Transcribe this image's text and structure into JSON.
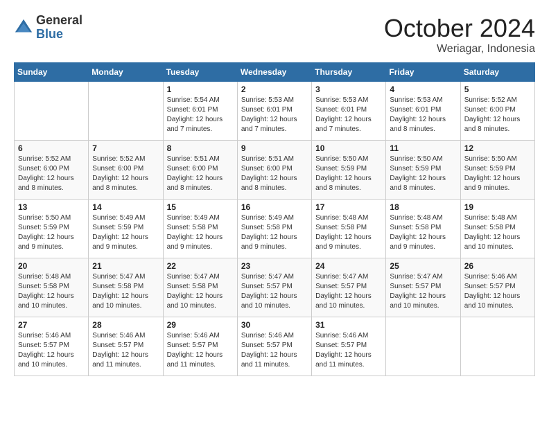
{
  "logo": {
    "general": "General",
    "blue": "Blue"
  },
  "header": {
    "month": "October 2024",
    "location": "Weriagar, Indonesia"
  },
  "weekdays": [
    "Sunday",
    "Monday",
    "Tuesday",
    "Wednesday",
    "Thursday",
    "Friday",
    "Saturday"
  ],
  "weeks": [
    [
      {
        "day": "",
        "sunrise": "",
        "sunset": "",
        "daylight": ""
      },
      {
        "day": "",
        "sunrise": "",
        "sunset": "",
        "daylight": ""
      },
      {
        "day": "1",
        "sunrise": "Sunrise: 5:54 AM",
        "sunset": "Sunset: 6:01 PM",
        "daylight": "Daylight: 12 hours and 7 minutes."
      },
      {
        "day": "2",
        "sunrise": "Sunrise: 5:53 AM",
        "sunset": "Sunset: 6:01 PM",
        "daylight": "Daylight: 12 hours and 7 minutes."
      },
      {
        "day": "3",
        "sunrise": "Sunrise: 5:53 AM",
        "sunset": "Sunset: 6:01 PM",
        "daylight": "Daylight: 12 hours and 7 minutes."
      },
      {
        "day": "4",
        "sunrise": "Sunrise: 5:53 AM",
        "sunset": "Sunset: 6:01 PM",
        "daylight": "Daylight: 12 hours and 8 minutes."
      },
      {
        "day": "5",
        "sunrise": "Sunrise: 5:52 AM",
        "sunset": "Sunset: 6:00 PM",
        "daylight": "Daylight: 12 hours and 8 minutes."
      }
    ],
    [
      {
        "day": "6",
        "sunrise": "Sunrise: 5:52 AM",
        "sunset": "Sunset: 6:00 PM",
        "daylight": "Daylight: 12 hours and 8 minutes."
      },
      {
        "day": "7",
        "sunrise": "Sunrise: 5:52 AM",
        "sunset": "Sunset: 6:00 PM",
        "daylight": "Daylight: 12 hours and 8 minutes."
      },
      {
        "day": "8",
        "sunrise": "Sunrise: 5:51 AM",
        "sunset": "Sunset: 6:00 PM",
        "daylight": "Daylight: 12 hours and 8 minutes."
      },
      {
        "day": "9",
        "sunrise": "Sunrise: 5:51 AM",
        "sunset": "Sunset: 6:00 PM",
        "daylight": "Daylight: 12 hours and 8 minutes."
      },
      {
        "day": "10",
        "sunrise": "Sunrise: 5:50 AM",
        "sunset": "Sunset: 5:59 PM",
        "daylight": "Daylight: 12 hours and 8 minutes."
      },
      {
        "day": "11",
        "sunrise": "Sunrise: 5:50 AM",
        "sunset": "Sunset: 5:59 PM",
        "daylight": "Daylight: 12 hours and 8 minutes."
      },
      {
        "day": "12",
        "sunrise": "Sunrise: 5:50 AM",
        "sunset": "Sunset: 5:59 PM",
        "daylight": "Daylight: 12 hours and 9 minutes."
      }
    ],
    [
      {
        "day": "13",
        "sunrise": "Sunrise: 5:50 AM",
        "sunset": "Sunset: 5:59 PM",
        "daylight": "Daylight: 12 hours and 9 minutes."
      },
      {
        "day": "14",
        "sunrise": "Sunrise: 5:49 AM",
        "sunset": "Sunset: 5:59 PM",
        "daylight": "Daylight: 12 hours and 9 minutes."
      },
      {
        "day": "15",
        "sunrise": "Sunrise: 5:49 AM",
        "sunset": "Sunset: 5:58 PM",
        "daylight": "Daylight: 12 hours and 9 minutes."
      },
      {
        "day": "16",
        "sunrise": "Sunrise: 5:49 AM",
        "sunset": "Sunset: 5:58 PM",
        "daylight": "Daylight: 12 hours and 9 minutes."
      },
      {
        "day": "17",
        "sunrise": "Sunrise: 5:48 AM",
        "sunset": "Sunset: 5:58 PM",
        "daylight": "Daylight: 12 hours and 9 minutes."
      },
      {
        "day": "18",
        "sunrise": "Sunrise: 5:48 AM",
        "sunset": "Sunset: 5:58 PM",
        "daylight": "Daylight: 12 hours and 9 minutes."
      },
      {
        "day": "19",
        "sunrise": "Sunrise: 5:48 AM",
        "sunset": "Sunset: 5:58 PM",
        "daylight": "Daylight: 12 hours and 10 minutes."
      }
    ],
    [
      {
        "day": "20",
        "sunrise": "Sunrise: 5:48 AM",
        "sunset": "Sunset: 5:58 PM",
        "daylight": "Daylight: 12 hours and 10 minutes."
      },
      {
        "day": "21",
        "sunrise": "Sunrise: 5:47 AM",
        "sunset": "Sunset: 5:58 PM",
        "daylight": "Daylight: 12 hours and 10 minutes."
      },
      {
        "day": "22",
        "sunrise": "Sunrise: 5:47 AM",
        "sunset": "Sunset: 5:58 PM",
        "daylight": "Daylight: 12 hours and 10 minutes."
      },
      {
        "day": "23",
        "sunrise": "Sunrise: 5:47 AM",
        "sunset": "Sunset: 5:57 PM",
        "daylight": "Daylight: 12 hours and 10 minutes."
      },
      {
        "day": "24",
        "sunrise": "Sunrise: 5:47 AM",
        "sunset": "Sunset: 5:57 PM",
        "daylight": "Daylight: 12 hours and 10 minutes."
      },
      {
        "day": "25",
        "sunrise": "Sunrise: 5:47 AM",
        "sunset": "Sunset: 5:57 PM",
        "daylight": "Daylight: 12 hours and 10 minutes."
      },
      {
        "day": "26",
        "sunrise": "Sunrise: 5:46 AM",
        "sunset": "Sunset: 5:57 PM",
        "daylight": "Daylight: 12 hours and 10 minutes."
      }
    ],
    [
      {
        "day": "27",
        "sunrise": "Sunrise: 5:46 AM",
        "sunset": "Sunset: 5:57 PM",
        "daylight": "Daylight: 12 hours and 10 minutes."
      },
      {
        "day": "28",
        "sunrise": "Sunrise: 5:46 AM",
        "sunset": "Sunset: 5:57 PM",
        "daylight": "Daylight: 12 hours and 11 minutes."
      },
      {
        "day": "29",
        "sunrise": "Sunrise: 5:46 AM",
        "sunset": "Sunset: 5:57 PM",
        "daylight": "Daylight: 12 hours and 11 minutes."
      },
      {
        "day": "30",
        "sunrise": "Sunrise: 5:46 AM",
        "sunset": "Sunset: 5:57 PM",
        "daylight": "Daylight: 12 hours and 11 minutes."
      },
      {
        "day": "31",
        "sunrise": "Sunrise: 5:46 AM",
        "sunset": "Sunset: 5:57 PM",
        "daylight": "Daylight: 12 hours and 11 minutes."
      },
      {
        "day": "",
        "sunrise": "",
        "sunset": "",
        "daylight": ""
      },
      {
        "day": "",
        "sunrise": "",
        "sunset": "",
        "daylight": ""
      }
    ]
  ]
}
